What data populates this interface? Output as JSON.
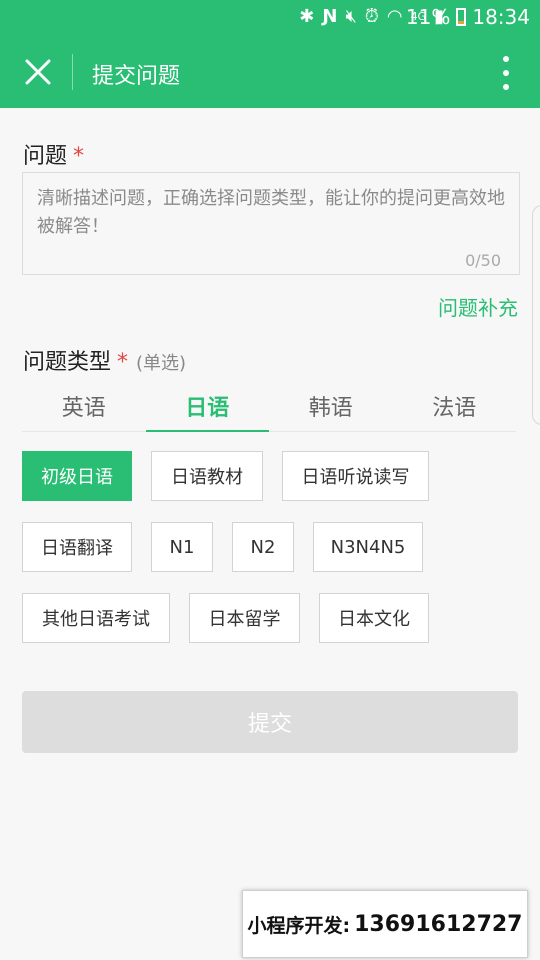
{
  "status_bar": {
    "battery": "11%",
    "time": "18:34",
    "network": "4G",
    "icons": [
      "bluetooth-icon",
      "nfc-icon",
      "mute-icon",
      "alarm-icon",
      "wifi-icon",
      "signal-icon",
      "battery-icon"
    ]
  },
  "header": {
    "title": "提交问题",
    "close_icon": "close-icon",
    "menu_icon": "more-vert-icon"
  },
  "question": {
    "label": "问题",
    "required_mark": "*",
    "placeholder": "清晰描述问题，正确选择问题类型，能让你的提问更高效地被解答！",
    "counter": "0/50",
    "supplement_link": "问题补充"
  },
  "type": {
    "label": "问题类型",
    "required_mark": "*",
    "hint": "(单选)",
    "tabs": [
      {
        "label": "英语",
        "active": false
      },
      {
        "label": "日语",
        "active": true
      },
      {
        "label": "韩语",
        "active": false
      },
      {
        "label": "法语",
        "active": false
      }
    ],
    "options": [
      {
        "label": "初级日语",
        "selected": true
      },
      {
        "label": "日语教材",
        "selected": false
      },
      {
        "label": "日语听说读写",
        "selected": false
      },
      {
        "label": "日语翻译",
        "selected": false
      },
      {
        "label": "N1",
        "selected": false
      },
      {
        "label": "N2",
        "selected": false
      },
      {
        "label": "N3N4N5",
        "selected": false
      },
      {
        "label": "其他日语考试",
        "selected": false
      },
      {
        "label": "日本留学",
        "selected": false
      },
      {
        "label": "日本文化",
        "selected": false
      }
    ]
  },
  "submit_label": "提交",
  "promo": {
    "label": "小程序开发:",
    "phone": "13691612727"
  },
  "colors": {
    "brand": "#29be74",
    "required": "#e54545",
    "disabled_button": "#dddddd"
  }
}
